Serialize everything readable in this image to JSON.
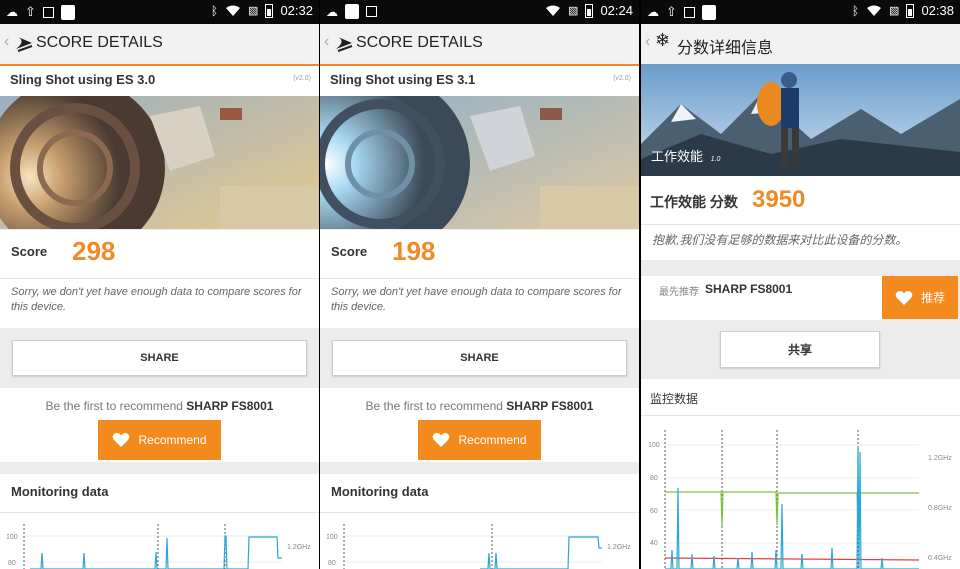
{
  "panels": [
    {
      "status_time": "02:32",
      "header_title": "SCORE DETAILS",
      "test_name": "Sling Shot using ES 3.0",
      "version": "(v2.0)",
      "score_label": "Score",
      "score_value": "298",
      "sorry_text": "Sorry, we don't yet have enough data to compare scores for this device.",
      "share_label": "SHARE",
      "recommend_prefix": "Be the first to recommend",
      "device_name": "SHARP FS8001",
      "recommend_label": "Recommend",
      "monitoring_title": "Monitoring data",
      "y_ticks": [
        "100",
        "80"
      ],
      "freq_tick": "1.2GHz"
    },
    {
      "status_time": "02:24",
      "header_title": "SCORE DETAILS",
      "test_name": "Sling Shot using ES 3.1",
      "version": "(v2.0)",
      "score_label": "Score",
      "score_value": "198",
      "sorry_text": "Sorry, we don't yet have enough data to compare scores for this device.",
      "share_label": "SHARE",
      "recommend_prefix": "Be the first to recommend",
      "device_name": "SHARP FS8001",
      "recommend_label": "Recommend",
      "monitoring_title": "Monitoring data",
      "y_ticks": [
        "100",
        "80"
      ],
      "freq_tick": "1.2GHz"
    },
    {
      "status_time": "02:38",
      "header_title": "分数详细信息",
      "banner_title": "工作效能",
      "banner_version": "1.0",
      "score_label": "工作效能 分数",
      "score_value": "3950",
      "sorry_text": "抱歉,我们没有足够的数据来对比此设备的分数。",
      "recommend_prefix": "最先推荐",
      "device_name": "SHARP FS8001",
      "recommend_label": "推荐",
      "share_label": "共享",
      "monitoring_title": "监控数据",
      "y_ticks": [
        "100",
        "80",
        "60",
        "40"
      ],
      "freq_ticks": [
        "1.2GHz",
        "0.8GHz",
        "0.4GHz"
      ]
    }
  ],
  "colors": {
    "accent": "#f08a24",
    "cpu_line": "#2aa7d8",
    "freq_line": "#7ac143",
    "temp_line": "#e04040"
  },
  "icons": [
    "3dmark-logo-icon",
    "3dmark-snowflake-logo-icon",
    "heart-icon",
    "wifi-icon",
    "bluetooth-icon",
    "battery-icon"
  ]
}
